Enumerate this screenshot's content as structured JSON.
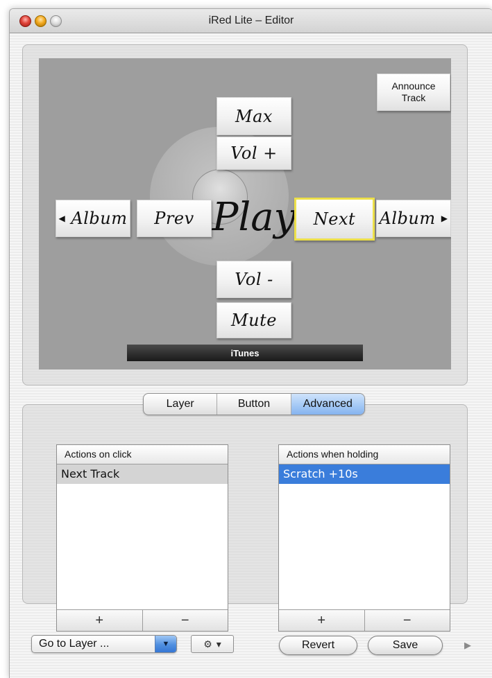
{
  "window": {
    "title": "iRed Lite – Editor"
  },
  "remote": {
    "announce_line1": "Announce",
    "announce_line2": "Track",
    "max": "Max",
    "vol_plus": "Vol +",
    "album_left": "Album",
    "album_right": "Album",
    "prev": "Prev",
    "play": "Play",
    "next": "Next",
    "vol_minus": "Vol -",
    "mute": "Mute",
    "device": "iTunes",
    "selected_button": "Next"
  },
  "tabs": [
    {
      "label": "Layer",
      "active": false
    },
    {
      "label": "Button",
      "active": false
    },
    {
      "label": "Advanced",
      "active": true
    }
  ],
  "click_actions": {
    "header": "Actions on click",
    "items": [
      "Next Track"
    ],
    "add": "+",
    "remove": "−"
  },
  "hold_actions": {
    "header": "Actions when holding",
    "items": [
      "Scratch +10s"
    ],
    "add": "+",
    "remove": "−"
  },
  "bottom": {
    "goto_layer": "Go to Layer ...",
    "gear_menu": "▾",
    "revert": "Revert",
    "save": "Save"
  },
  "colors": {
    "canvas_bg": "#9e9e9e",
    "selection_outline": "#ede04a",
    "selected_row": "#3a7ddb",
    "active_tab": "#a9ccf6"
  }
}
